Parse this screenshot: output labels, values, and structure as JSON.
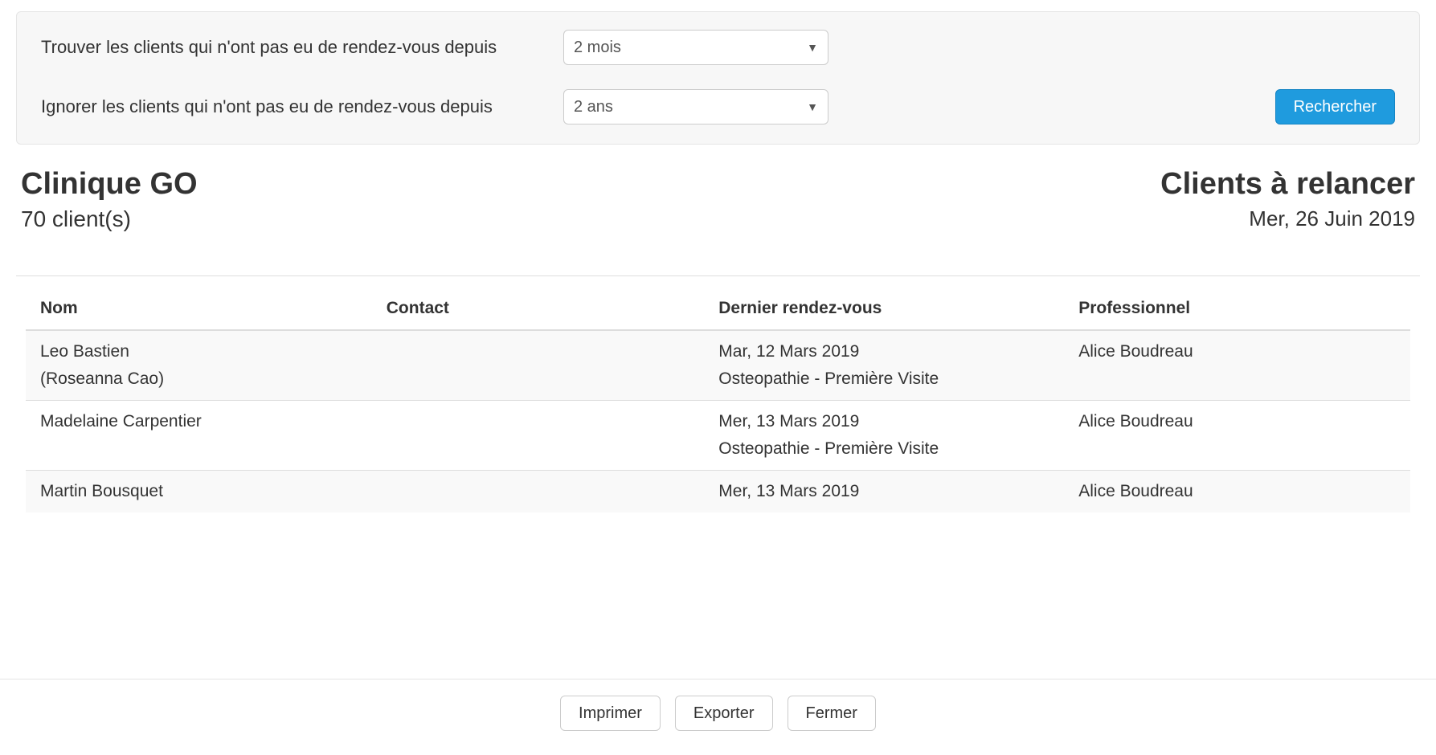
{
  "filters": {
    "find_label": "Trouver les clients qui n'ont pas eu de rendez-vous depuis",
    "find_value": "2 mois",
    "ignore_label": "Ignorer les clients qui n'ont pas eu de rendez-vous depuis",
    "ignore_value": "2 ans",
    "search_label": "Rechercher"
  },
  "header": {
    "clinic_name": "Clinique GO",
    "client_count_text": "70 client(s)",
    "report_title": "Clients à relancer",
    "report_date": "Mer, 26 Juin 2019"
  },
  "table": {
    "columns": {
      "name": "Nom",
      "contact": "Contact",
      "last_appt": "Dernier rendez-vous",
      "professional": "Professionnel"
    },
    "rows": [
      {
        "name": "Leo Bastien",
        "name_sub": "(Roseanna Cao)",
        "contact": "",
        "last_date": "Mar, 12 Mars 2019",
        "last_service": "Osteopathie - Première Visite",
        "professional": "Alice Boudreau"
      },
      {
        "name": "Madelaine Carpentier",
        "name_sub": "",
        "contact": "",
        "last_date": "Mer, 13 Mars 2019",
        "last_service": "Osteopathie - Première Visite",
        "professional": "Alice Boudreau"
      },
      {
        "name": "Martin Bousquet",
        "name_sub": "",
        "contact": "",
        "last_date": "Mer, 13 Mars 2019",
        "last_service": "",
        "professional": "Alice Boudreau"
      }
    ]
  },
  "footer": {
    "print": "Imprimer",
    "export": "Exporter",
    "close": "Fermer"
  }
}
